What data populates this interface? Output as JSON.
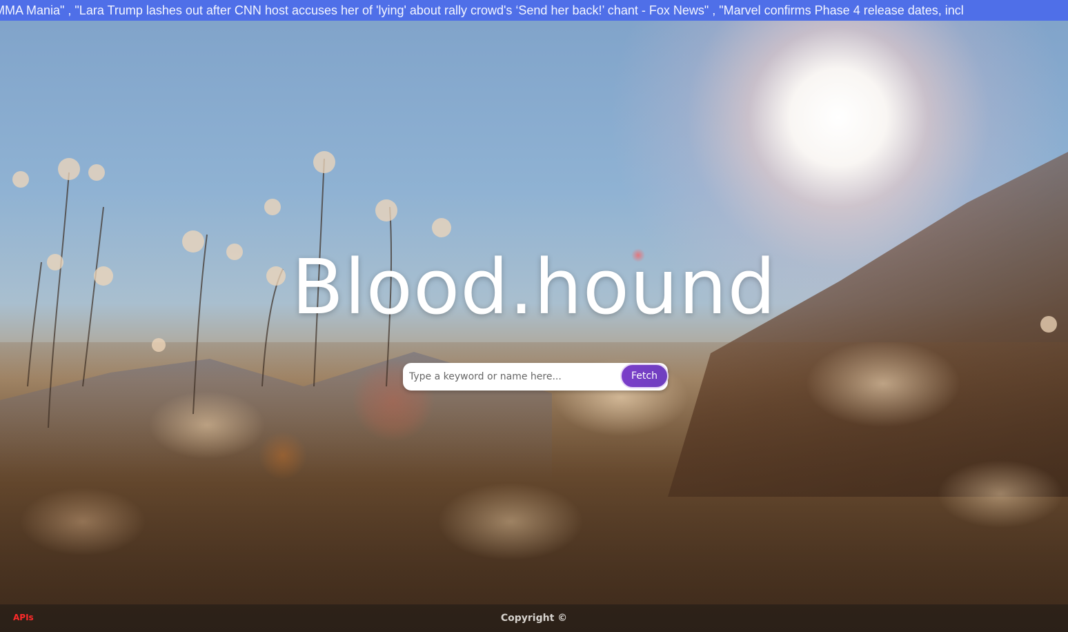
{
  "ticker": {
    "text": "MMA Mania\" , \"Lara Trump lashes out after CNN host accuses her of 'lying' about rally crowd's ‘Send her back!’ chant - Fox News\" , \"Marvel confirms Phase 4 release dates, incl"
  },
  "hero": {
    "title": "Blood.hound"
  },
  "search": {
    "placeholder": "Type a keyword or name here...",
    "value": "",
    "button_label": "Fetch"
  },
  "footer": {
    "apis_label": "APIs",
    "copyright": "Copyright ©"
  },
  "colors": {
    "ticker_bg": "#4f6fe8",
    "button_bg": "#7a3dc9",
    "apis_link": "#ff2a2a"
  }
}
